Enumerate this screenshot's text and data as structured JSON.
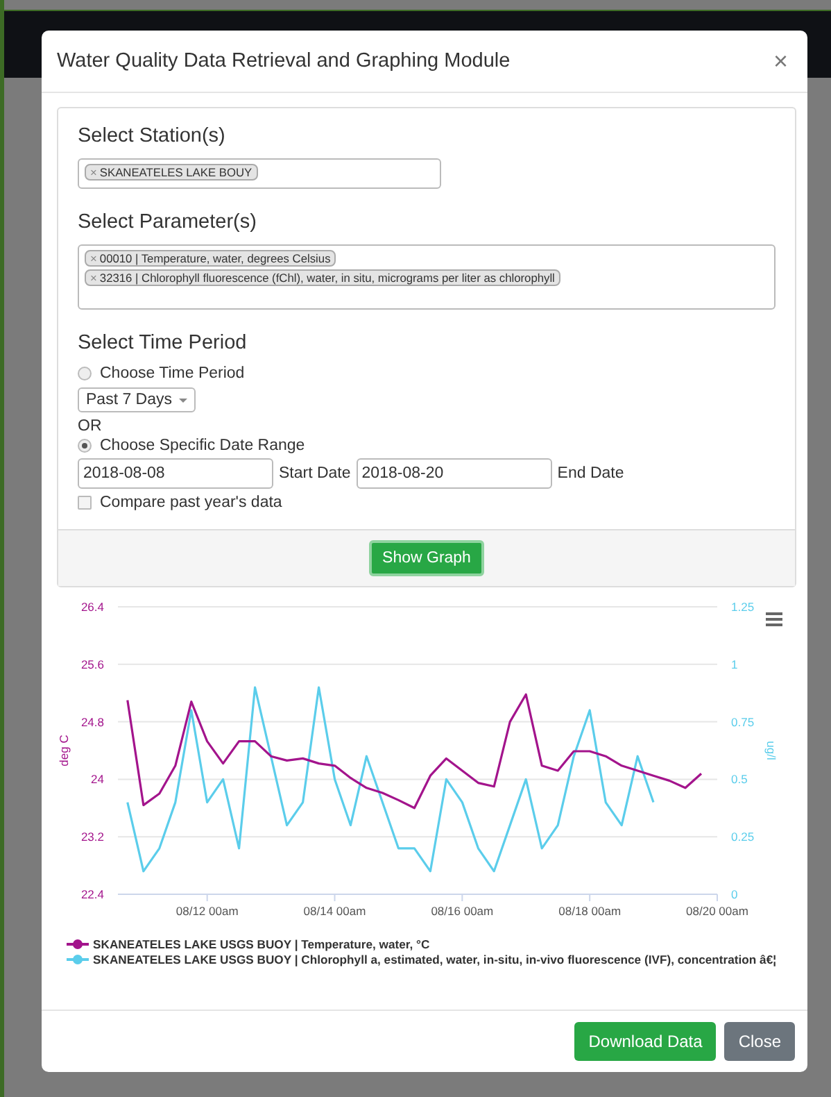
{
  "modal": {
    "title": "Water Quality Data Retrieval and Graphing Module",
    "close": "×"
  },
  "station": {
    "heading": "Select Station(s)",
    "tags": [
      {
        "remove": "×",
        "label": "SKANEATELES LAKE BOUY"
      }
    ]
  },
  "parameter": {
    "heading": "Select Parameter(s)",
    "tags": [
      {
        "remove": "×",
        "label": "00010 | Temperature, water, degrees Celsius"
      },
      {
        "remove": "×",
        "label": "32316 | Chlorophyll fluorescence (fChl), water, in situ, micrograms per liter as chlorophyll"
      }
    ]
  },
  "time": {
    "heading": "Select Time Period",
    "period_option": {
      "label": "Choose Time Period",
      "selected": false
    },
    "period_select": {
      "value": "Past 7 Days"
    },
    "or_text": "OR",
    "range_option": {
      "label": "Choose Specific Date Range",
      "selected": true
    },
    "start_date": {
      "value": "2018-08-08",
      "label": "Start Date"
    },
    "end_date": {
      "value": "2018-08-20",
      "label": "End Date"
    },
    "compare": {
      "label": "Compare past year's data",
      "checked": false
    }
  },
  "show_graph": "Show Graph",
  "chart_data": {
    "type": "line",
    "ylabel": "deg C",
    "y2label": "ug/l",
    "categories": [
      null,
      null,
      null,
      null,
      null,
      "08/12 00am",
      null,
      null,
      null,
      null,
      null,
      null,
      null,
      "08/14 00am",
      null,
      null,
      null,
      null,
      null,
      null,
      null,
      "08/16 00am",
      null,
      null,
      null,
      null,
      null,
      null,
      null,
      "08/18 00am",
      null,
      null,
      null,
      null,
      null,
      null,
      null,
      "08/20 00am"
    ],
    "series": [
      {
        "name": "SKANEATELES LAKE USGS BUOY | Temperature, water, °C",
        "color": "#a3148c",
        "values": [
          25.1,
          23.64,
          23.8,
          24.19,
          25.08,
          24.53,
          24.22,
          24.53,
          24.53,
          24.32,
          24.26,
          24.29,
          24.22,
          24.19,
          24.02,
          23.88,
          23.81,
          23.71,
          23.6,
          24.05,
          24.29,
          24.12,
          23.95,
          23.9,
          24.8,
          25.18,
          24.19,
          24.12,
          24.39,
          24.39,
          24.32,
          24.19,
          24.12,
          24.05,
          23.98,
          23.88,
          24.08,
          null
        ]
      },
      {
        "name": "SKANEATELES LAKE USGS BUOY | Chlorophyll a, estimated, water, in-situ, in-vivo fluorescence (IVF), concentration â€¦",
        "color": "#5bcdeb",
        "axis": "y2",
        "values": [
          0.4,
          0.1,
          0.2,
          0.4,
          0.8,
          0.4,
          0.5,
          0.2,
          0.9,
          0.6,
          0.3,
          0.4,
          0.9,
          0.5,
          0.3,
          0.6,
          0.4,
          0.2,
          0.2,
          0.1,
          0.5,
          0.4,
          0.2,
          0.1,
          0.3,
          0.5,
          0.2,
          0.3,
          0.6,
          0.8,
          0.4,
          0.3,
          0.6,
          0.4,
          null,
          null,
          null,
          null
        ]
      }
    ],
    "grid": true,
    "legend": "bottom",
    "ylim": [
      22.4,
      26.4
    ],
    "y2lim": [
      0,
      1.25
    ],
    "yticks": [
      {
        "value": 22.4,
        "label": "22.4"
      },
      {
        "value": 23.2,
        "label": "23.2"
      },
      {
        "value": 24,
        "label": "24"
      },
      {
        "value": 24.8,
        "label": "24.8"
      },
      {
        "value": 25.6,
        "label": "25.6"
      },
      {
        "value": 26.4,
        "label": "26.4"
      }
    ],
    "y2ticks": [
      {
        "value": 0,
        "label": "0"
      },
      {
        "value": 0.25,
        "label": "0.25"
      },
      {
        "value": 0.5,
        "label": "0.5"
      },
      {
        "value": 0.75,
        "label": "0.75"
      },
      {
        "value": 1,
        "label": "1"
      },
      {
        "value": 1.25,
        "label": "1.25"
      }
    ]
  },
  "footer": {
    "download": "Download Data",
    "close": "Close"
  }
}
